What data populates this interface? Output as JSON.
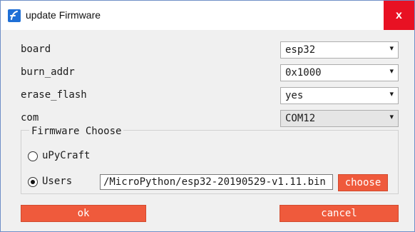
{
  "window": {
    "title": "update Firmware",
    "close_label": "x"
  },
  "fields": [
    {
      "label": "board",
      "value": "esp32"
    },
    {
      "label": "burn_addr",
      "value": "0x1000"
    },
    {
      "label": "erase_flash",
      "value": "yes"
    },
    {
      "label": "com",
      "value": "COM12"
    }
  ],
  "firmware": {
    "group_label": "Firmware Choose",
    "option_upycraft": "uPyCraft",
    "option_users": "Users",
    "selected": "Users",
    "path_value": "/MicroPython/esp32-20190529-v1.11.bin",
    "choose_label": "choose"
  },
  "actions": {
    "ok_label": "ok",
    "cancel_label": "cancel"
  },
  "colors": {
    "accent": "#ef5a3c",
    "close": "#e81123",
    "icon": "#1f6fd6"
  }
}
